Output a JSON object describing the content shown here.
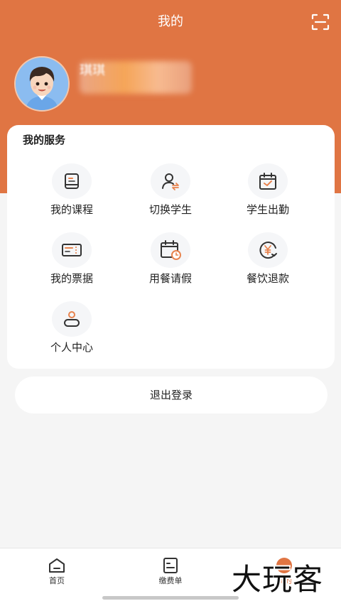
{
  "header": {
    "title": "我的",
    "scan_icon": "scan-icon",
    "background_color": "#e07543"
  },
  "profile": {
    "name": "琪琪",
    "avatar_icon": "avatar-boy"
  },
  "services": {
    "title": "我的服务",
    "items": [
      {
        "label": "我的课程",
        "icon": "book-icon"
      },
      {
        "label": "切换学生",
        "icon": "switch-user-icon"
      },
      {
        "label": "学生出勤",
        "icon": "calendar-check-icon"
      },
      {
        "label": "我的票据",
        "icon": "receipt-icon"
      },
      {
        "label": "用餐请假",
        "icon": "calendar-clock-icon"
      },
      {
        "label": "餐饮退款",
        "icon": "yuan-refund-icon"
      },
      {
        "label": "个人中心",
        "icon": "person-icon"
      }
    ]
  },
  "logout": {
    "label": "退出登录"
  },
  "tabbar": {
    "items": [
      {
        "label": "首页",
        "icon": "home-icon"
      },
      {
        "label": "缴费单",
        "icon": "bill-icon"
      },
      {
        "label": "我的",
        "icon": "mine-icon"
      }
    ]
  },
  "watermark": {
    "text": "大玩客"
  }
}
